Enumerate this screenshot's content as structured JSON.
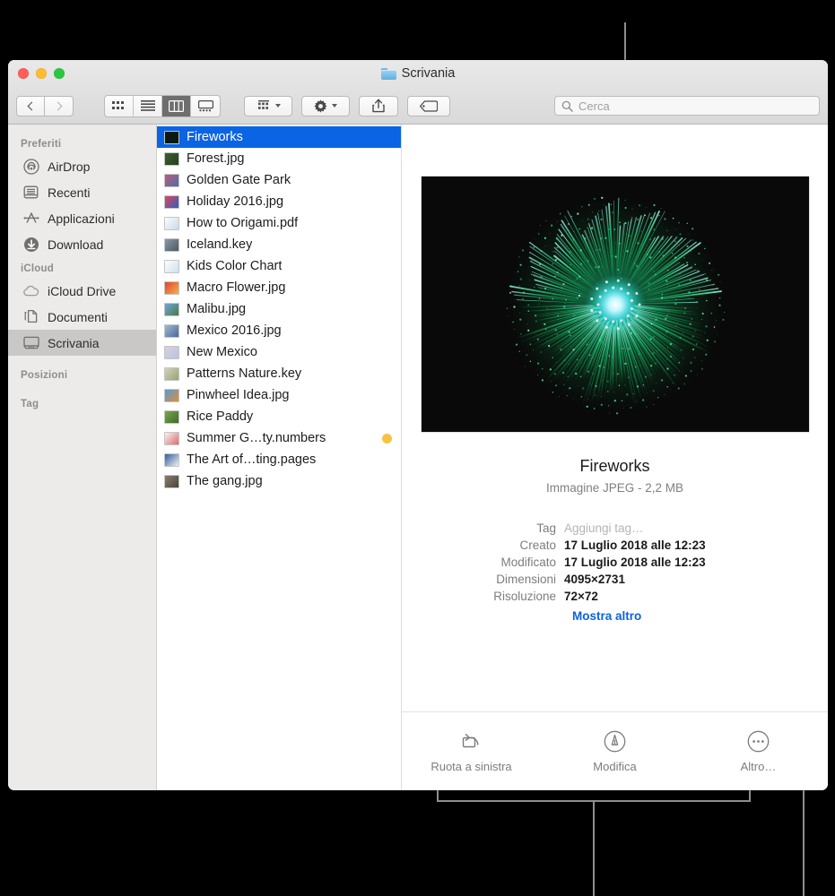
{
  "window": {
    "title": "Scrivania",
    "title_icon": "folder-icon",
    "traffic_lights": [
      {
        "name": "close",
        "color": "#ff5f57"
      },
      {
        "name": "minimize",
        "color": "#febc2e"
      },
      {
        "name": "zoom",
        "color": "#28c840"
      }
    ]
  },
  "toolbar": {
    "back_label": "‹",
    "forward_label": "›",
    "view_buttons": [
      {
        "name": "icon-view",
        "icon": "grid-icon",
        "active": false
      },
      {
        "name": "list-view",
        "icon": "list-icon",
        "active": false
      },
      {
        "name": "column-view",
        "icon": "columns-icon",
        "active": true
      },
      {
        "name": "gallery-view",
        "icon": "gallery-icon",
        "active": false
      }
    ],
    "group_button": {
      "name": "arrange-button",
      "icon": "arrange-icon"
    },
    "action_button": {
      "name": "action-button",
      "icon": "gear-icon"
    },
    "share_button": {
      "name": "share-button",
      "icon": "share-icon"
    },
    "tag_button": {
      "name": "tag-button",
      "icon": "tag-icon"
    }
  },
  "search": {
    "placeholder": "Cerca",
    "icon": "search-icon",
    "value": ""
  },
  "sidebar": {
    "sections": [
      {
        "heading": "Preferiti",
        "items": [
          {
            "label": "AirDrop",
            "icon": "airdrop-icon",
            "selected": false
          },
          {
            "label": "Recenti",
            "icon": "recents-icon",
            "selected": false
          },
          {
            "label": "Applicazioni",
            "icon": "applications-icon",
            "selected": false
          },
          {
            "label": "Download",
            "icon": "downloads-icon",
            "selected": false
          }
        ]
      },
      {
        "heading": "iCloud",
        "items": [
          {
            "label": "iCloud Drive",
            "icon": "cloud-icon",
            "selected": false
          },
          {
            "label": "Documenti",
            "icon": "documents-icon",
            "selected": false
          },
          {
            "label": "Scrivania",
            "icon": "desktop-icon",
            "selected": true
          }
        ]
      },
      {
        "heading": "Posizioni",
        "items": []
      },
      {
        "heading": "Tag",
        "items": []
      }
    ]
  },
  "file_list": {
    "items": [
      {
        "name": "Fireworks",
        "selected": true,
        "thumb": "#0a1a12",
        "thumb2": "#0a1a12",
        "tag": null
      },
      {
        "name": "Forest.jpg",
        "selected": false,
        "thumb": "#3f5e33",
        "thumb2": "#26401f",
        "tag": null
      },
      {
        "name": "Golden Gate Park",
        "selected": false,
        "thumb": "#c05a7e",
        "thumb2": "#4a6fa8",
        "tag": null
      },
      {
        "name": "Holiday 2016.jpg",
        "selected": false,
        "thumb": "#e2465a",
        "thumb2": "#2e5ec0",
        "tag": null
      },
      {
        "name": "How to Origami.pdf",
        "selected": false,
        "thumb": "#fdfdfd",
        "thumb2": "#c8d8e8",
        "tag": null
      },
      {
        "name": "Iceland.key",
        "selected": false,
        "thumb": "#8c99a3",
        "thumb2": "#4a5a66",
        "tag": null
      },
      {
        "name": "Kids Color Chart",
        "selected": false,
        "thumb": "#fdfdfd",
        "thumb2": "#cfe0ef",
        "tag": null
      },
      {
        "name": "Macro Flower.jpg",
        "selected": false,
        "thumb": "#e2452f",
        "thumb2": "#f2b24a",
        "tag": null
      },
      {
        "name": "Malibu.jpg",
        "selected": false,
        "thumb": "#6fa8d8",
        "thumb2": "#4a7a46",
        "tag": null
      },
      {
        "name": "Mexico 2016.jpg",
        "selected": false,
        "thumb": "#9fb8d8",
        "thumb2": "#4a6a96",
        "tag": null
      },
      {
        "name": "New Mexico",
        "selected": false,
        "thumb": "#d8d0e0",
        "thumb2": "#b8c4dc",
        "tag": null
      },
      {
        "name": "Patterns Nature.key",
        "selected": false,
        "thumb": "#d8cfc0",
        "thumb2": "#8fa86a",
        "tag": null
      },
      {
        "name": "Pinwheel Idea.jpg",
        "selected": false,
        "thumb": "#4a9fd8",
        "thumb2": "#e88a3a",
        "tag": null
      },
      {
        "name": "Rice Paddy",
        "selected": false,
        "thumb": "#7aa84a",
        "thumb2": "#3f6a2a",
        "tag": null
      },
      {
        "name": "Summer G…ty.numbers",
        "selected": false,
        "thumb": "#f4f4f4",
        "thumb2": "#e06a6a",
        "tag": "#f5c344"
      },
      {
        "name": "The Art of…ting.pages",
        "selected": false,
        "thumb": "#2e5e9e",
        "thumb2": "#f0f0f0",
        "tag": null
      },
      {
        "name": "The gang.jpg",
        "selected": false,
        "thumb": "#8b8070",
        "thumb2": "#4a4238",
        "tag": null
      }
    ]
  },
  "preview": {
    "image_alt": "fireworks-burst-image",
    "name": "Fireworks",
    "subtitle": "Immagine JPEG - 2,2 MB",
    "metadata": [
      {
        "key": "Tag",
        "value": "Aggiungi tag…",
        "placeholder": true
      },
      {
        "key": "Creato",
        "value": "17 Luglio 2018 alle 12:23",
        "placeholder": false
      },
      {
        "key": "Modificato",
        "value": "17 Luglio 2018 alle 12:23",
        "placeholder": false
      },
      {
        "key": "Dimensioni",
        "value": "4095×2731",
        "placeholder": false
      },
      {
        "key": "Risoluzione",
        "value": "72×72",
        "placeholder": false
      }
    ],
    "show_more_label": "Mostra altro",
    "quick_actions": [
      {
        "label": "Ruota a sinistra",
        "icon": "rotate-left-icon"
      },
      {
        "label": "Modifica",
        "icon": "markup-icon"
      },
      {
        "label": "Altro…",
        "icon": "more-icon"
      }
    ]
  },
  "colors": {
    "selection_blue": "#0a64e4",
    "link_blue": "#0b63e0",
    "sidebar_bg": "#ecebe9",
    "callout_line": "#8e8e8e"
  }
}
